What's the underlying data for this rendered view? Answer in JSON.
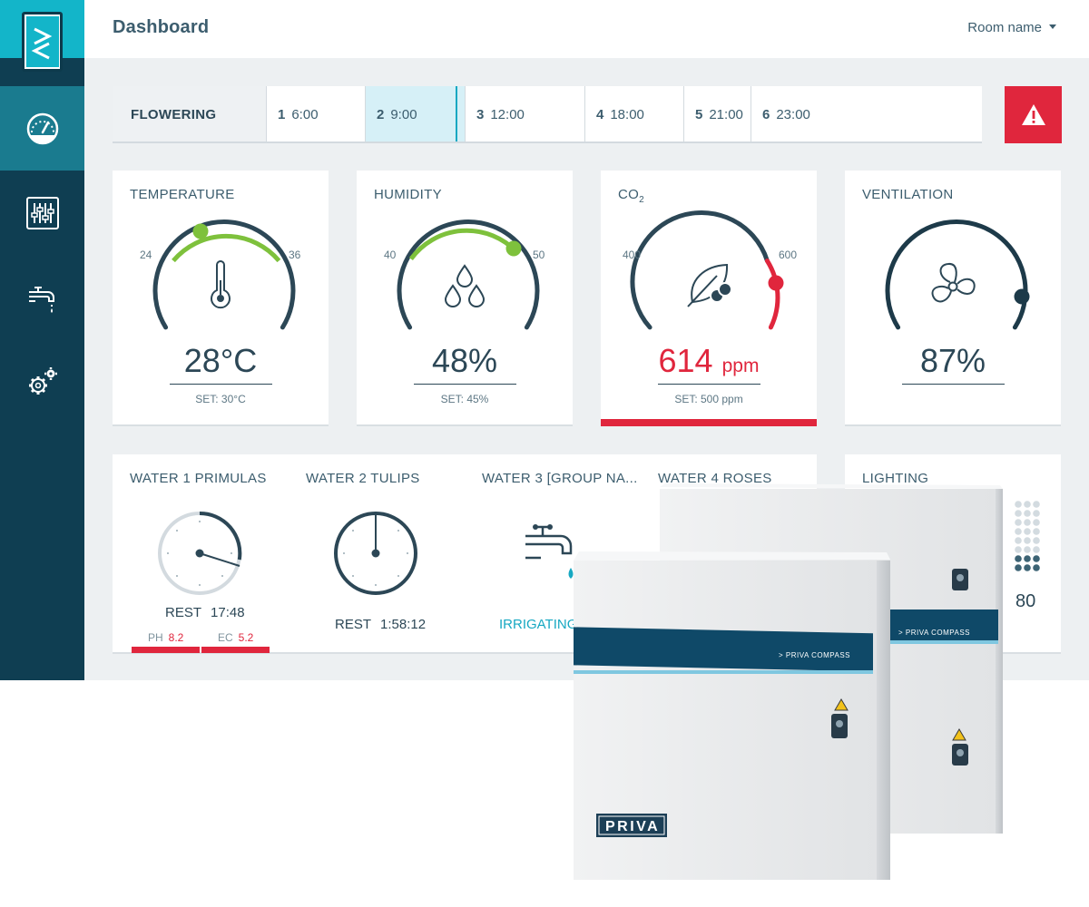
{
  "app": {
    "title": "Dashboard",
    "room_select": "Room name"
  },
  "sidebar": {
    "items": [
      {
        "icon": "dashboard-gauge-icon",
        "active": true
      },
      {
        "icon": "sliders-icon",
        "active": false
      },
      {
        "icon": "water-tap-icon",
        "active": false
      },
      {
        "icon": "settings-gears-icon",
        "active": false
      }
    ]
  },
  "phase": {
    "name": "FLOWERING",
    "steps": [
      {
        "num": "1",
        "time": "6:00"
      },
      {
        "num": "2",
        "time": "9:00",
        "active": true
      },
      {
        "num": "3",
        "time": "12:00"
      },
      {
        "num": "4",
        "time": "18:00"
      },
      {
        "num": "5",
        "time": "21:00"
      },
      {
        "num": "6",
        "time": "23:00"
      }
    ],
    "alarm_icon": "warning-triangle-icon"
  },
  "climate": {
    "temperature": {
      "title": "TEMPERATURE",
      "min": "24",
      "max": "36",
      "value": "28°C",
      "setpoint": "SET: 30°C",
      "icon": "thermometer-icon"
    },
    "humidity": {
      "title": "HUMIDITY",
      "min": "40",
      "max": "50",
      "value": "48%",
      "setpoint": "SET: 45%",
      "icon": "water-drops-icon"
    },
    "co2": {
      "title": "CO",
      "title_sub": "2",
      "min": "400",
      "max": "600",
      "value": "614",
      "unit": "ppm",
      "setpoint": "SET: 500 ppm",
      "icon": "leaf-icon"
    },
    "ventilation": {
      "title": "VENTILATION",
      "value": "87%",
      "icon": "fan-icon"
    }
  },
  "water": [
    {
      "title": "WATER 1 PRIMULAS",
      "status": "REST",
      "time": "17:48",
      "ph_label": "PH",
      "ph": "8.2",
      "ec_label": "EC",
      "ec": "5.2",
      "icon": "timer-clock-icon"
    },
    {
      "title": "WATER 2 TULIPS",
      "status": "REST",
      "time": "1:58:12",
      "icon": "timer-clock-icon"
    },
    {
      "title": "WATER 3 [GROUP NA...",
      "status": "IRRIGATING",
      "icon": "faucet-icon"
    },
    {
      "title": "WATER 4 ROSES"
    }
  ],
  "lighting": {
    "title": "LIGHTING",
    "value": "80"
  },
  "hardware": {
    "brand": "PRIVA",
    "model_label": "> PRIVA COMPASS"
  },
  "colors": {
    "navy": "#0f3e52",
    "teal": "#13b5c9",
    "accent_green": "#7ec13c",
    "alert_red": "#e0263d",
    "text": "#2c4756"
  }
}
